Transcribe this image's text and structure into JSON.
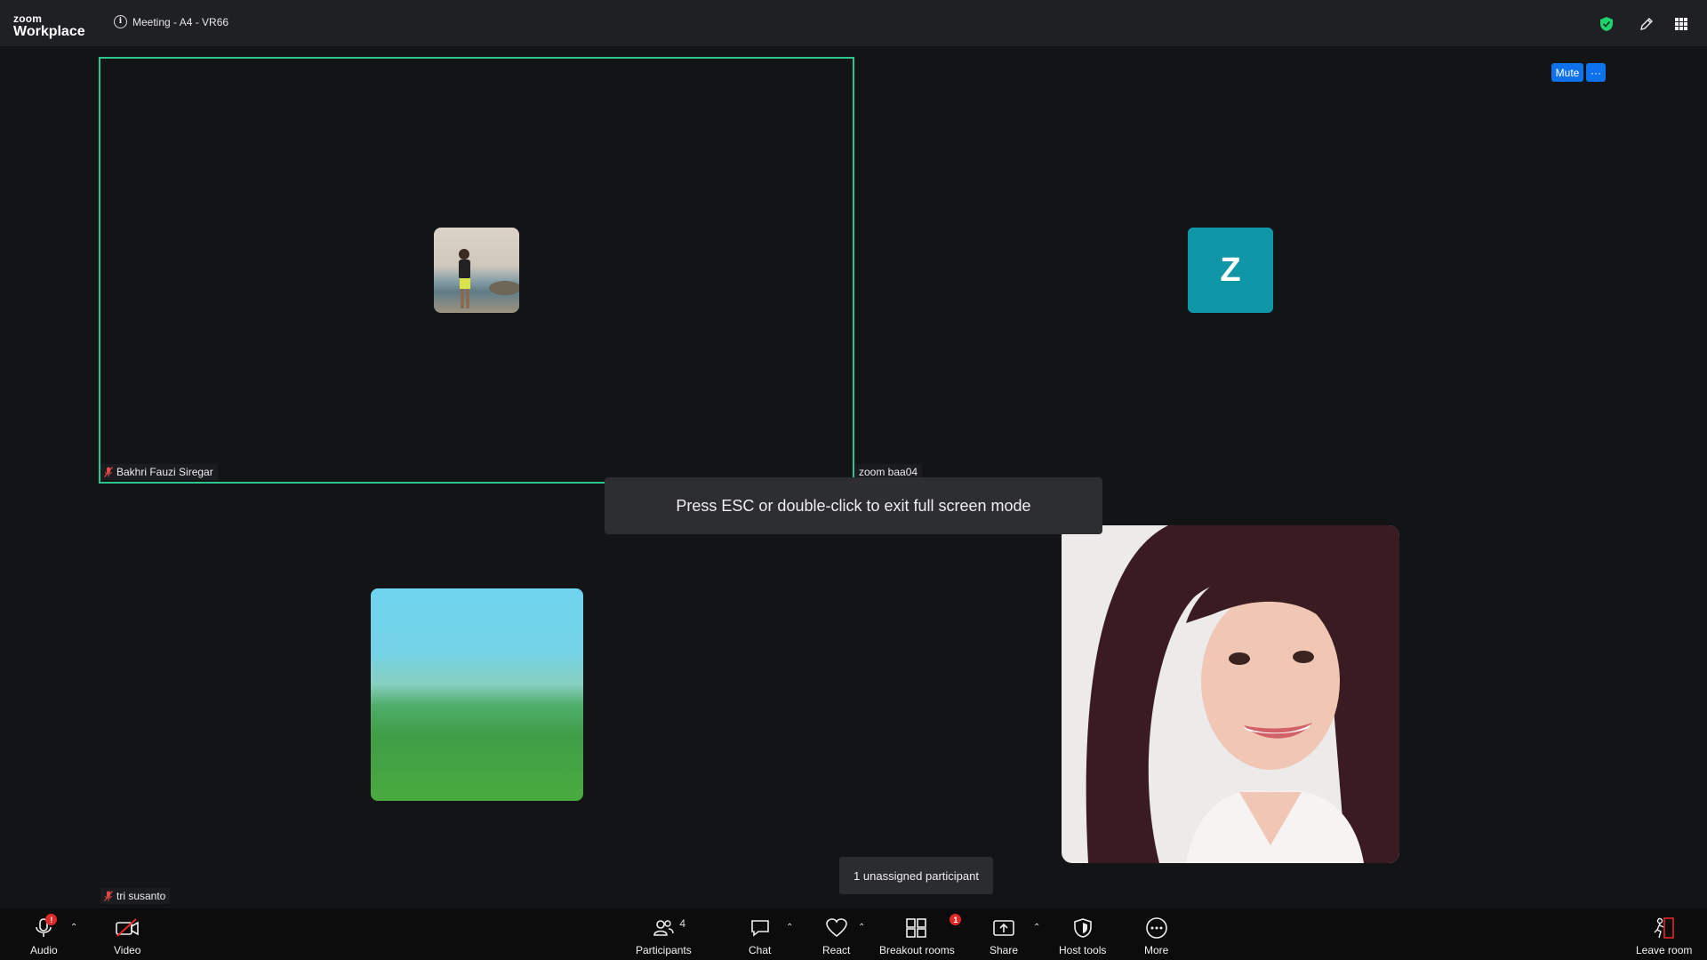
{
  "app": {
    "logo_small": "zoom",
    "logo_big": "Workplace"
  },
  "meeting": {
    "title": "Meeting - A4 - VR66"
  },
  "tiles": {
    "speaker_name": "Bakhri Fauzi Siregar",
    "zoom_name": "zoom baa04",
    "zoom_initial": "Z",
    "bottom_left_name": "tri susanto"
  },
  "controls": {
    "mute": "Mute",
    "more": "···"
  },
  "toast": {
    "esc": "Press ESC or double-click to exit full screen mode"
  },
  "popup": {
    "unassigned": "1 unassigned participant"
  },
  "toolbar": {
    "audio": "Audio",
    "video": "Video",
    "participants": "Participants",
    "participants_count": "4",
    "chat": "Chat",
    "react": "React",
    "breakout": "Breakout rooms",
    "breakout_badge": "1",
    "audio_badge": "!",
    "share": "Share",
    "host_tools": "Host tools",
    "more": "More",
    "leave": "Leave room"
  },
  "colors": {
    "accent": "#0e72ed",
    "active_border": "#29c78d",
    "avatar_bg": "#0f97a8",
    "badge": "#e02828",
    "shield": "#1ed36b"
  }
}
